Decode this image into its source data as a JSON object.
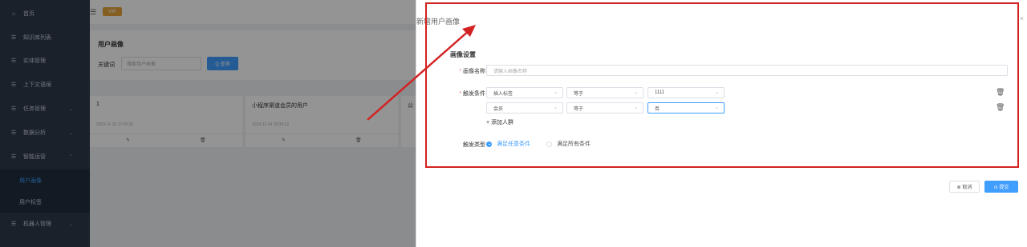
{
  "sidebar": {
    "items": [
      {
        "label": "首页",
        "icon": "home-icon",
        "glyph": "⌂"
      },
      {
        "label": "知识库列表",
        "icon": "list-icon",
        "glyph": "☰"
      },
      {
        "label": "实体管理",
        "icon": "list-icon",
        "glyph": "☰"
      },
      {
        "label": "上下文语境",
        "icon": "list-icon",
        "glyph": "☰"
      },
      {
        "label": "任务管理",
        "icon": "list-icon",
        "glyph": "☰"
      },
      {
        "label": "数据分析",
        "icon": "list-icon",
        "glyph": "☰"
      },
      {
        "label": "智能运营",
        "icon": "list-icon",
        "glyph": "☰"
      },
      {
        "label": "机器人管理",
        "icon": "list-icon",
        "glyph": "☰"
      }
    ],
    "sub_items": [
      {
        "label": "用户画像",
        "active": true
      },
      {
        "label": "用户标签",
        "active": false
      }
    ],
    "chevron_glyph": "⌄"
  },
  "topbar": {
    "menu_glyph": "☰",
    "vip_label": "VIP"
  },
  "panel": {
    "title": "用户画像",
    "keyword_label": "关键词",
    "keyword_placeholder": "搜索用户画像",
    "query_button": "Q 查询"
  },
  "cards": [
    {
      "title": "1",
      "time": "2023-11-15 17:42:30"
    },
    {
      "title": "小程序渠道会员的用户",
      "time": "2023-11-14 15:09:12"
    },
    {
      "title": "公",
      "time": ""
    }
  ],
  "card_footer": {
    "edit_glyph": "✎",
    "delete_glyph": "🗑"
  },
  "drawer": {
    "title": "新增用户画像",
    "close_glyph": "×",
    "section_title": "画像设置",
    "name_label": "画像名称",
    "name_placeholder": "请输入画像名称",
    "trigger_label": "触发条件",
    "conditions": [
      {
        "field": "插入标签",
        "op": "等于",
        "value": "1111"
      },
      {
        "field": "会员",
        "op": "等于",
        "value": "否"
      }
    ],
    "add_crowd": "+ 添加人群",
    "trigger_type_label": "触发类型",
    "radio_any": "满足任意条件",
    "radio_all": "满足所有条件",
    "cancel": "⊗ 取消",
    "submit": "⊙ 提交",
    "required_mark": "*",
    "arrow_glyph": "⌄",
    "trash_glyph": "🗑"
  },
  "colors": {
    "accent": "#409eff",
    "sidebar_bg": "#2d3a4b",
    "annotation_red": "#d32222",
    "vip": "#e6a23c"
  }
}
